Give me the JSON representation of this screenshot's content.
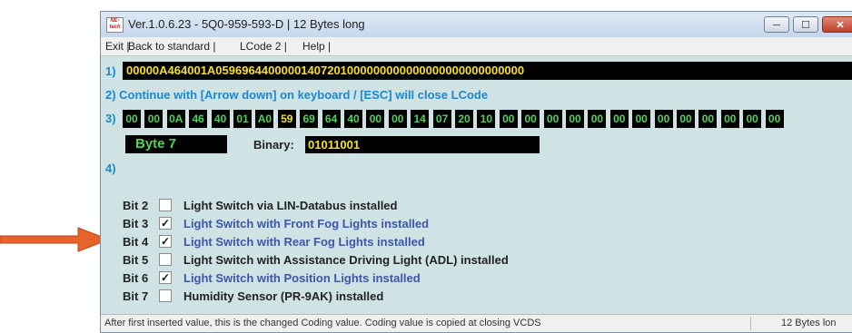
{
  "window": {
    "title": "Ver.1.0.6.23 -  5Q0-959-593-D | 12 Bytes long",
    "app_icon_text": "NE-tech",
    "app_icon": "ne-tech-logo-icon",
    "controls": {
      "minimize": "─",
      "maximize": "☐",
      "close": "✕"
    }
  },
  "menu": {
    "exit": "Exit |",
    "back": "Back to standard |",
    "lcode": "LCode 2 |",
    "help": "Help |"
  },
  "row1": {
    "label": "1)",
    "value": "00000A464001A05969644000001407201000000000000000000000000000"
  },
  "row2": {
    "text": "2) Continue with [Arrow down] on keyboard / [ESC] will close LCode"
  },
  "row3": {
    "label": "3)",
    "bytes": [
      "00",
      "00",
      "0A",
      "46",
      "40",
      "01",
      "A0",
      "59",
      "69",
      "64",
      "40",
      "00",
      "00",
      "14",
      "07",
      "20",
      "10",
      "00",
      "00",
      "00",
      "00",
      "00",
      "00",
      "00",
      "00",
      "00",
      "00",
      "00",
      "00",
      "00"
    ],
    "selected_index": 7
  },
  "byte_info": {
    "byte_label": "Byte 7",
    "binary_label": "Binary:",
    "binary_value": "01011001"
  },
  "row4": {
    "label": "4)"
  },
  "bits": [
    {
      "label": "Bit 2",
      "checked": false,
      "check_mark": "",
      "text": "Light Switch via LIN-Databus installed"
    },
    {
      "label": "Bit 3",
      "checked": true,
      "check_mark": "✓",
      "text": "Light Switch with Front Fog Lights installed"
    },
    {
      "label": "Bit 4",
      "checked": true,
      "check_mark": "✓",
      "text": "Light Switch with Rear Fog Lights installed"
    },
    {
      "label": "Bit 5",
      "checked": false,
      "check_mark": "",
      "text": "Light Switch with Assistance Driving Light (ADL) installed"
    },
    {
      "label": "Bit 6",
      "checked": true,
      "check_mark": "✓",
      "text": "Light Switch with Position Lights installed"
    },
    {
      "label": "Bit 7",
      "checked": false,
      "check_mark": "",
      "text": "Humidity Sensor (PR-9AK) installed"
    }
  ],
  "status": {
    "left": "After first inserted value, this is the changed Coding value.  Coding value is copied at closing VCDS",
    "right": "12 Bytes lon"
  },
  "colors": {
    "arrow": "#e8622c",
    "accent_blue": "#1a88d0",
    "byte_green": "#4fd35a",
    "value_yellow": "#f5e01f",
    "checked_text": "#3d56a6"
  }
}
